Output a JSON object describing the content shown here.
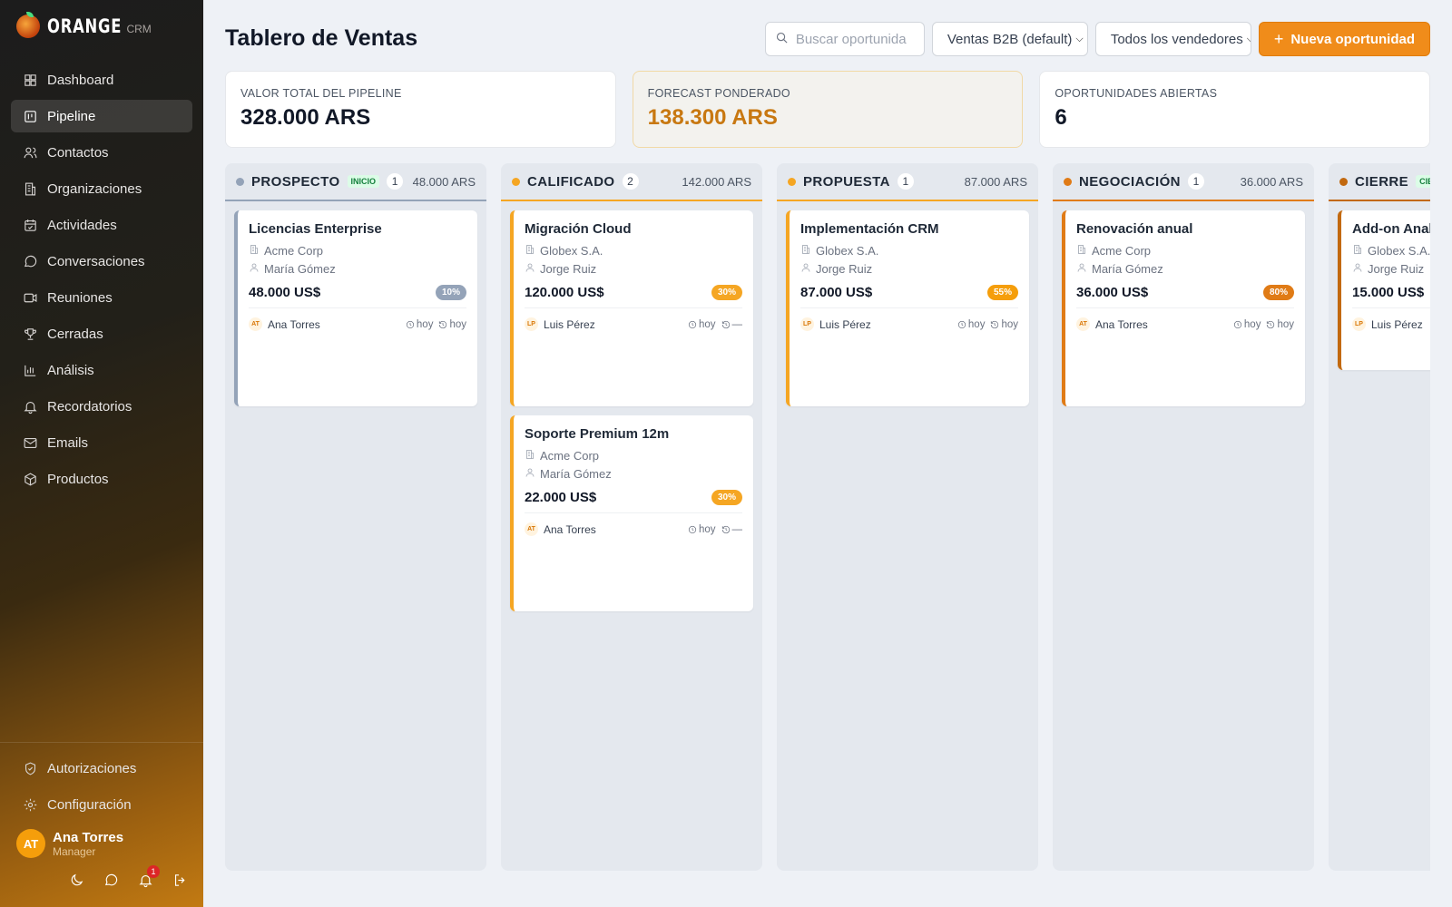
{
  "brand": {
    "name": "ORANGE",
    "sub": "CRM"
  },
  "nav": [
    {
      "label": "Dashboard",
      "icon": "dashboard-icon"
    },
    {
      "label": "Pipeline",
      "icon": "pipeline-icon"
    },
    {
      "label": "Contactos",
      "icon": "contacts-icon"
    },
    {
      "label": "Organizaciones",
      "icon": "building-icon"
    },
    {
      "label": "Actividades",
      "icon": "calendar-icon"
    },
    {
      "label": "Conversaciones",
      "icon": "chat-icon"
    },
    {
      "label": "Reuniones",
      "icon": "video-icon"
    },
    {
      "label": "Cerradas",
      "icon": "trophy-icon"
    },
    {
      "label": "Análisis",
      "icon": "bar-chart-icon"
    },
    {
      "label": "Recordatorios",
      "icon": "bell-icon"
    },
    {
      "label": "Emails",
      "icon": "mail-icon"
    },
    {
      "label": "Productos",
      "icon": "box-icon"
    }
  ],
  "nav_active": "Pipeline",
  "bottom_nav": [
    {
      "label": "Autorizaciones",
      "icon": "shield-check-icon"
    },
    {
      "label": "Configuración",
      "icon": "gear-icon"
    }
  ],
  "user": {
    "initials": "AT",
    "name": "Ana Torres",
    "role": "Manager",
    "notifications": "1"
  },
  "header": {
    "title": "Tablero de Ventas",
    "search_placeholder": "Buscar oportunida",
    "pipeline_select": "Ventas B2B (default)",
    "seller_select": "Todos los vendedores",
    "new_button": "Nueva oportunidad"
  },
  "stats": {
    "pipeline_label": "VALOR TOTAL DEL PIPELINE",
    "pipeline_value": "328.000 ARS",
    "forecast_label": "FORECAST PONDERADO",
    "forecast_value": "138.300 ARS",
    "open_label": "OPORTUNIDADES ABIERTAS",
    "open_value": "6"
  },
  "colors": {
    "accent": "#f08c1a",
    "prospect": "#94a3b8",
    "orange": "#f5a623",
    "dark_orange": "#e07b16",
    "cierre": "#c2690f"
  },
  "columns": [
    {
      "title": "PROSPECTO",
      "tag": "INICIO",
      "count": "1",
      "total": "48.000 ARS",
      "color": "#94a3b8",
      "cards": [
        {
          "title": "Licencias Enterprise",
          "org": "Acme Corp",
          "contact": "María Gómez",
          "amount": "48.000 US$",
          "prob": "10%",
          "prob_color": "#94a3b8",
          "owner_initials": "AT",
          "owner": "Ana Torres",
          "created": "hoy",
          "updated": "hoy"
        }
      ]
    },
    {
      "title": "CALIFICADO",
      "tag": "",
      "count": "2",
      "total": "142.000 ARS",
      "color": "#f5a623",
      "cards": [
        {
          "title": "Migración Cloud",
          "org": "Globex S.A.",
          "contact": "Jorge Ruiz",
          "amount": "120.000 US$",
          "prob": "30%",
          "prob_color": "#f5a623",
          "owner_initials": "LP",
          "owner": "Luis Pérez",
          "created": "hoy",
          "updated": "—"
        },
        {
          "title": "Soporte Premium 12m",
          "org": "Acme Corp",
          "contact": "María Gómez",
          "amount": "22.000 US$",
          "prob": "30%",
          "prob_color": "#f5a623",
          "owner_initials": "AT",
          "owner": "Ana Torres",
          "created": "hoy",
          "updated": "—"
        }
      ]
    },
    {
      "title": "PROPUESTA",
      "tag": "",
      "count": "1",
      "total": "87.000 ARS",
      "color": "#f5a623",
      "cards": [
        {
          "title": "Implementación CRM",
          "org": "Globex S.A.",
          "contact": "Jorge Ruiz",
          "amount": "87.000 US$",
          "prob": "55%",
          "prob_color": "#f59e0b",
          "owner_initials": "LP",
          "owner": "Luis Pérez",
          "created": "hoy",
          "updated": "hoy"
        }
      ]
    },
    {
      "title": "NEGOCIACIÓN",
      "tag": "",
      "count": "1",
      "total": "36.000 ARS",
      "color": "#e07b16",
      "cards": [
        {
          "title": "Renovación anual",
          "org": "Acme Corp",
          "contact": "María Gómez",
          "amount": "36.000 US$",
          "prob": "80%",
          "prob_color": "#e07b16",
          "owner_initials": "AT",
          "owner": "Ana Torres",
          "created": "hoy",
          "updated": "hoy"
        }
      ]
    },
    {
      "title": "CIERRE",
      "tag": "CIE",
      "count": "",
      "total": "",
      "color": "#c2690f",
      "cards": [
        {
          "title": "Add-on Anal",
          "org": "Globex S.A.",
          "contact": "Jorge Ruiz",
          "amount": "15.000 US$",
          "prob": "",
          "prob_color": "#c2690f",
          "owner_initials": "LP",
          "owner": "Luis Pérez",
          "created": "",
          "updated": ""
        }
      ]
    }
  ]
}
